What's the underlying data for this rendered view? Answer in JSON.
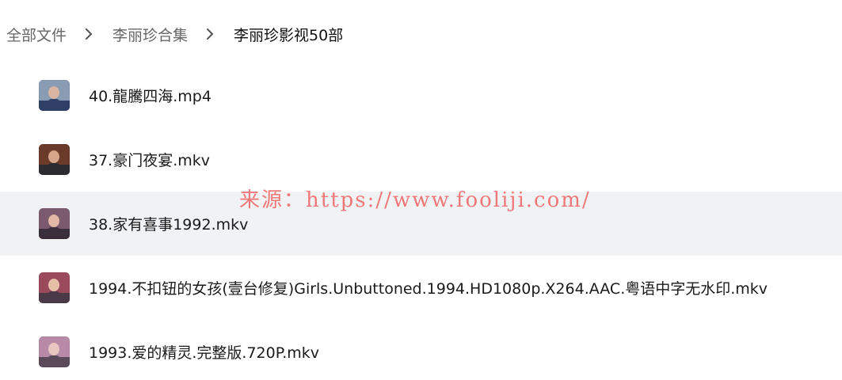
{
  "breadcrumb": {
    "items": [
      "全部文件",
      "李丽珍合集",
      "李丽珍影视50部"
    ],
    "separator_icon": "chevron-right-icon"
  },
  "files": [
    {
      "name": "40.龍騰四海.mp4",
      "thumb_colors": [
        "#8a9bb4",
        "#d9b6a3",
        "#2f3f66"
      ]
    },
    {
      "name": "37.豪门夜宴.mkv",
      "thumb_colors": [
        "#6b3b2a",
        "#d6a58a",
        "#2c2c30"
      ]
    },
    {
      "name": "38.家有喜事1992.mkv",
      "thumb_colors": [
        "#7b5a6e",
        "#e2b9a6",
        "#3a2e3a"
      ]
    },
    {
      "name": "1994.不扣钮的女孩(壹台修复)Girls.Unbuttoned.1994.HD1080p.X264.AAC.粤语中字无水印.mkv",
      "thumb_colors": [
        "#9b4a5e",
        "#e7c0a8",
        "#4a3a48"
      ]
    },
    {
      "name": "1993.爱的精灵.完整版.720P.mkv",
      "thumb_colors": [
        "#b88aa8",
        "#e9c6c0",
        "#5a4a5a"
      ]
    }
  ],
  "hovered_index": 2,
  "watermark": {
    "text": "来源：https://www.fooliji.com/",
    "color": "#f05050"
  }
}
